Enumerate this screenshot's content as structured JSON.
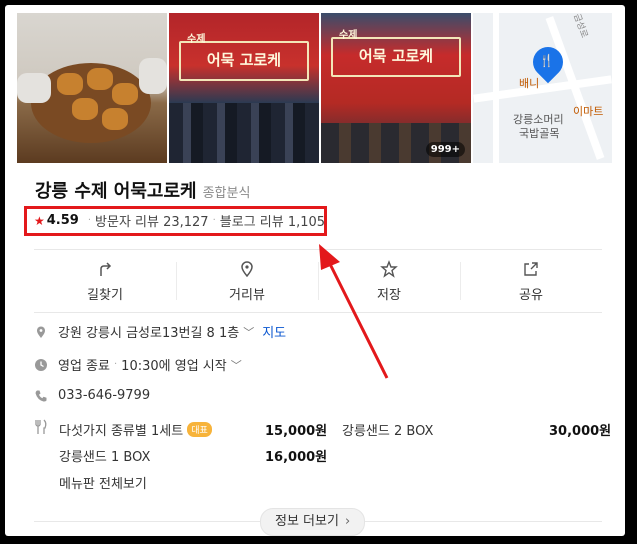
{
  "place": {
    "name": "강릉 수제 어묵고로케",
    "category": "종합분식",
    "rating": "4.59",
    "visitor_reviews": "방문자 리뷰 23,127",
    "blog_reviews": "블로그 리뷰 1,105"
  },
  "photos": {
    "sign_main": "어묵 고로케",
    "sign_small": "수제",
    "count_badge": "999+"
  },
  "map": {
    "label1": "강릉소머리",
    "label2": "국밥골목",
    "label3": "배니",
    "label4": "이마트",
    "label5": "금성로"
  },
  "actions": [
    {
      "label": "길찾기"
    },
    {
      "label": "거리뷰"
    },
    {
      "label": "저장"
    },
    {
      "label": "공유"
    }
  ],
  "info": {
    "address": "강원 강릉시 금성로13번길 8 1층",
    "map_link": "지도",
    "status": "영업 종료",
    "hours": "10:30에 영업 시작",
    "phone": "033-646-9799"
  },
  "menu": {
    "items": [
      {
        "name": "다섯가지 종류별 1세트",
        "badge": "대표",
        "price": "15,000원"
      },
      {
        "name": "강릉샌드 2 BOX",
        "price": "30,000원"
      },
      {
        "name": "강릉샌드 1 BOX",
        "price": "16,000원"
      }
    ],
    "view_all": "메뉴판 전체보기"
  },
  "more_info": "정보 더보기",
  "colors": {
    "highlight_red": "#e3181b",
    "link_blue": "#0b57d0",
    "badge_orange": "#f7b33a"
  }
}
